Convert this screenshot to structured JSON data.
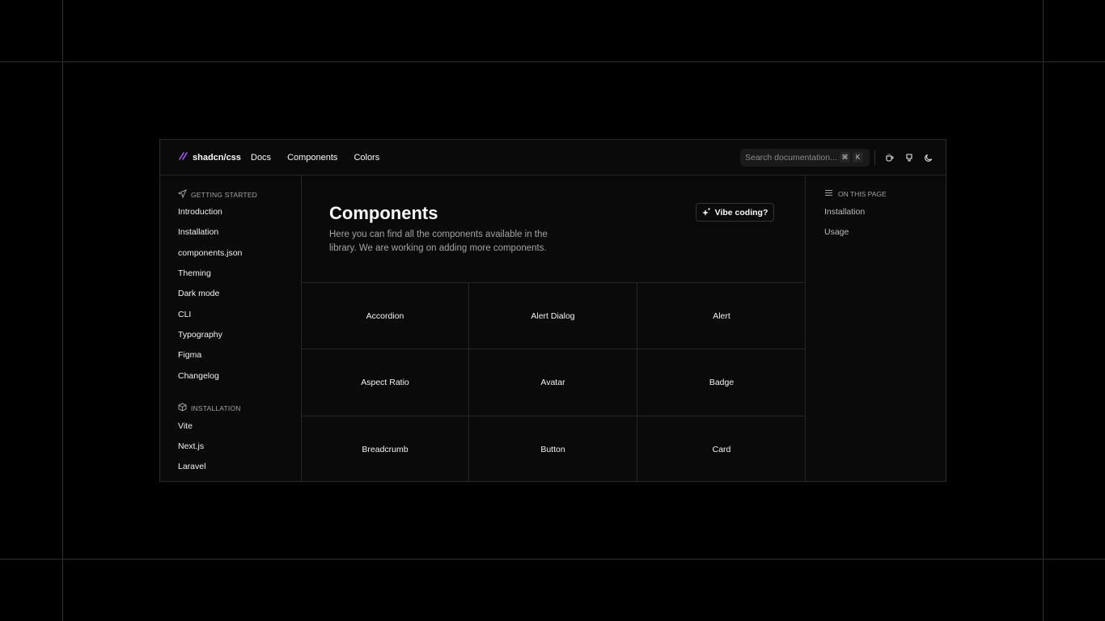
{
  "header": {
    "brand": "shadcn/css",
    "nav": [
      "Docs",
      "Components",
      "Colors"
    ],
    "search_placeholder": "Search documentation...",
    "search_kbd": [
      "⌘",
      "K"
    ]
  },
  "sidebar": {
    "getting_started": {
      "heading": "GETTING STARTED",
      "items": [
        "Introduction",
        "Installation",
        "components.json",
        "Theming",
        "Dark mode",
        "CLI",
        "Typography",
        "Figma",
        "Changelog"
      ]
    },
    "installation": {
      "heading": "INSTALLATION",
      "items": [
        "Vite",
        "Next.js",
        "Laravel"
      ]
    }
  },
  "main": {
    "title": "Components",
    "description": "Here you can find all the components available in the library. We are working on adding more components.",
    "vibe_button": "Vibe coding?",
    "components": [
      "Accordion",
      "Alert Dialog",
      "Alert",
      "Aspect Ratio",
      "Avatar",
      "Badge",
      "Breadcrumb",
      "Button",
      "Card"
    ]
  },
  "toc": {
    "heading": "ON THIS PAGE",
    "items": [
      "Installation",
      "Usage"
    ]
  },
  "colors": {
    "brand_accent": "#a855f7",
    "background": "#000000",
    "surface": "#0a0a0a",
    "border": "#262626"
  }
}
